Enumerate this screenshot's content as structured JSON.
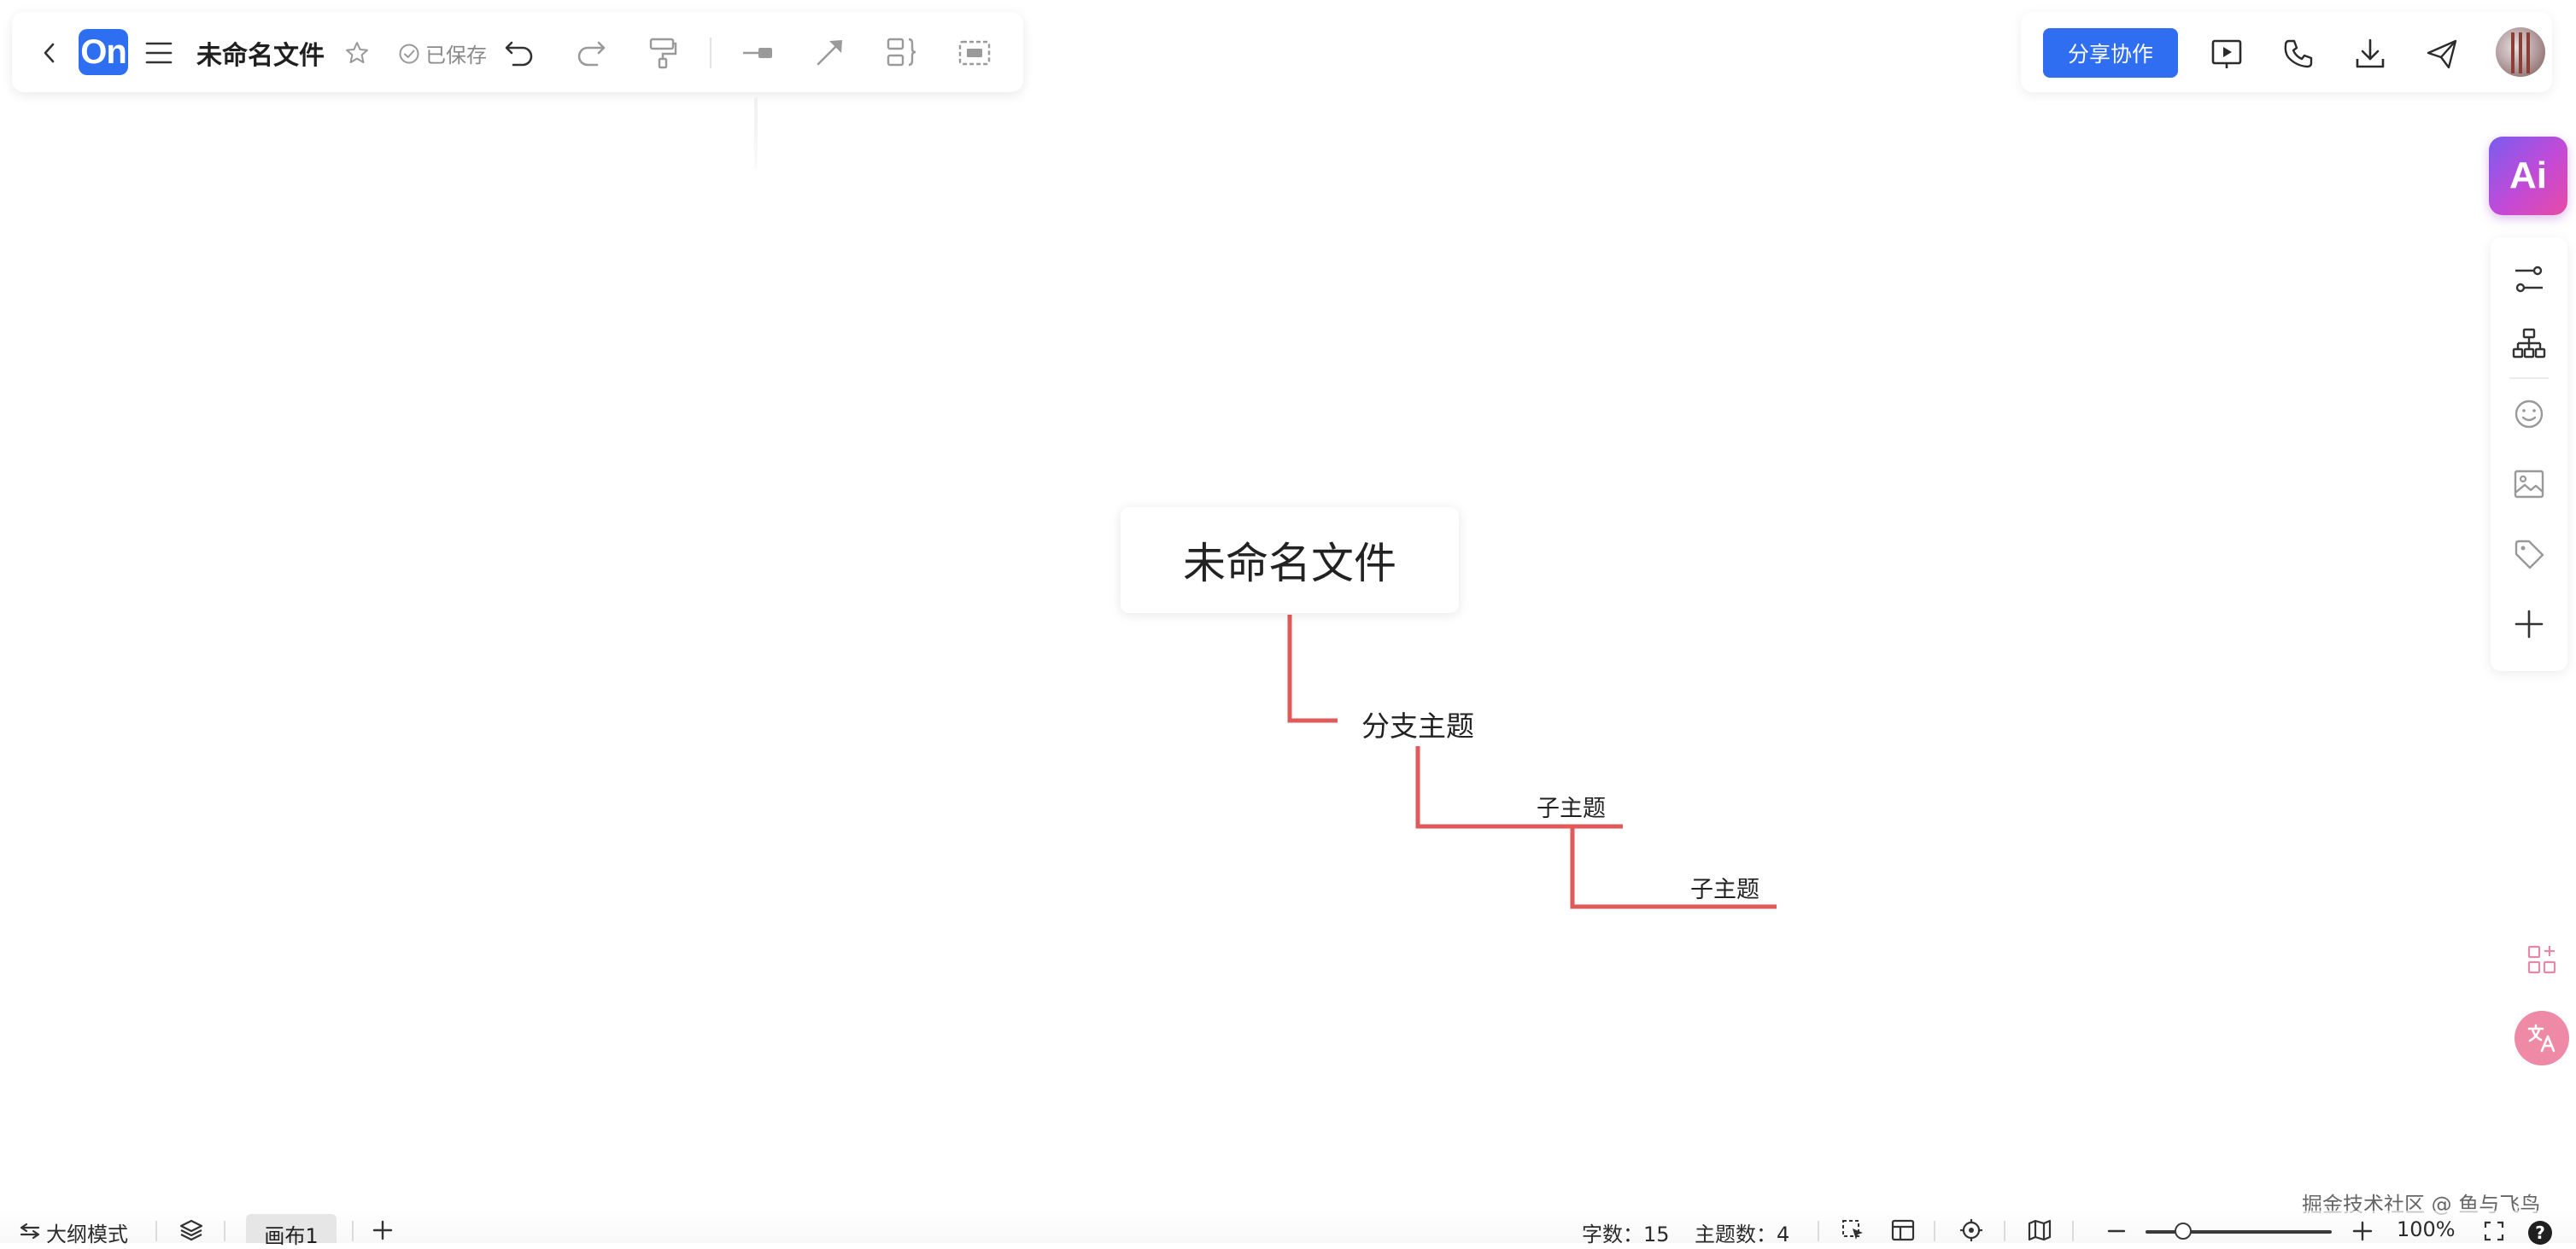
{
  "toolbar": {
    "logo_text": "On",
    "doc_title": "未命名文件",
    "saved_text": "已保存",
    "icons": [
      "back-icon",
      "menu-icon",
      "star-icon",
      "undo-icon",
      "redo-icon",
      "format-painter-icon",
      "connector-icon",
      "arrow-line-icon",
      "summary-icon",
      "boundary-icon"
    ]
  },
  "top_right": {
    "share_label": "分享协作",
    "icons": [
      "present-icon",
      "call-icon",
      "download-icon",
      "send-icon"
    ],
    "accent": "#2f6ef0"
  },
  "sidebar": {
    "ai_label": "Ai",
    "icons": [
      "relationship-icon",
      "structure-icon",
      "emoji-icon",
      "image-icon",
      "tag-icon",
      "add-icon"
    ]
  },
  "floating": {
    "icons": [
      "apps-icon",
      "translate-icon"
    ]
  },
  "mindmap": {
    "root": "未命名文件",
    "branch": "分支主题",
    "subtopic_1": "子主题",
    "subtopic_2": "子主题",
    "line_color": "#e05a5a"
  },
  "watermark": "掘金技术社区 @ 鱼与飞鸟",
  "bottom": {
    "outline_mode": "大纲模式",
    "canvas_tab": "画布1",
    "word_count": "字数：15",
    "topic_count": "主题数：4",
    "zoom": "100%",
    "zoom_fraction": 0.2,
    "help": "?"
  }
}
